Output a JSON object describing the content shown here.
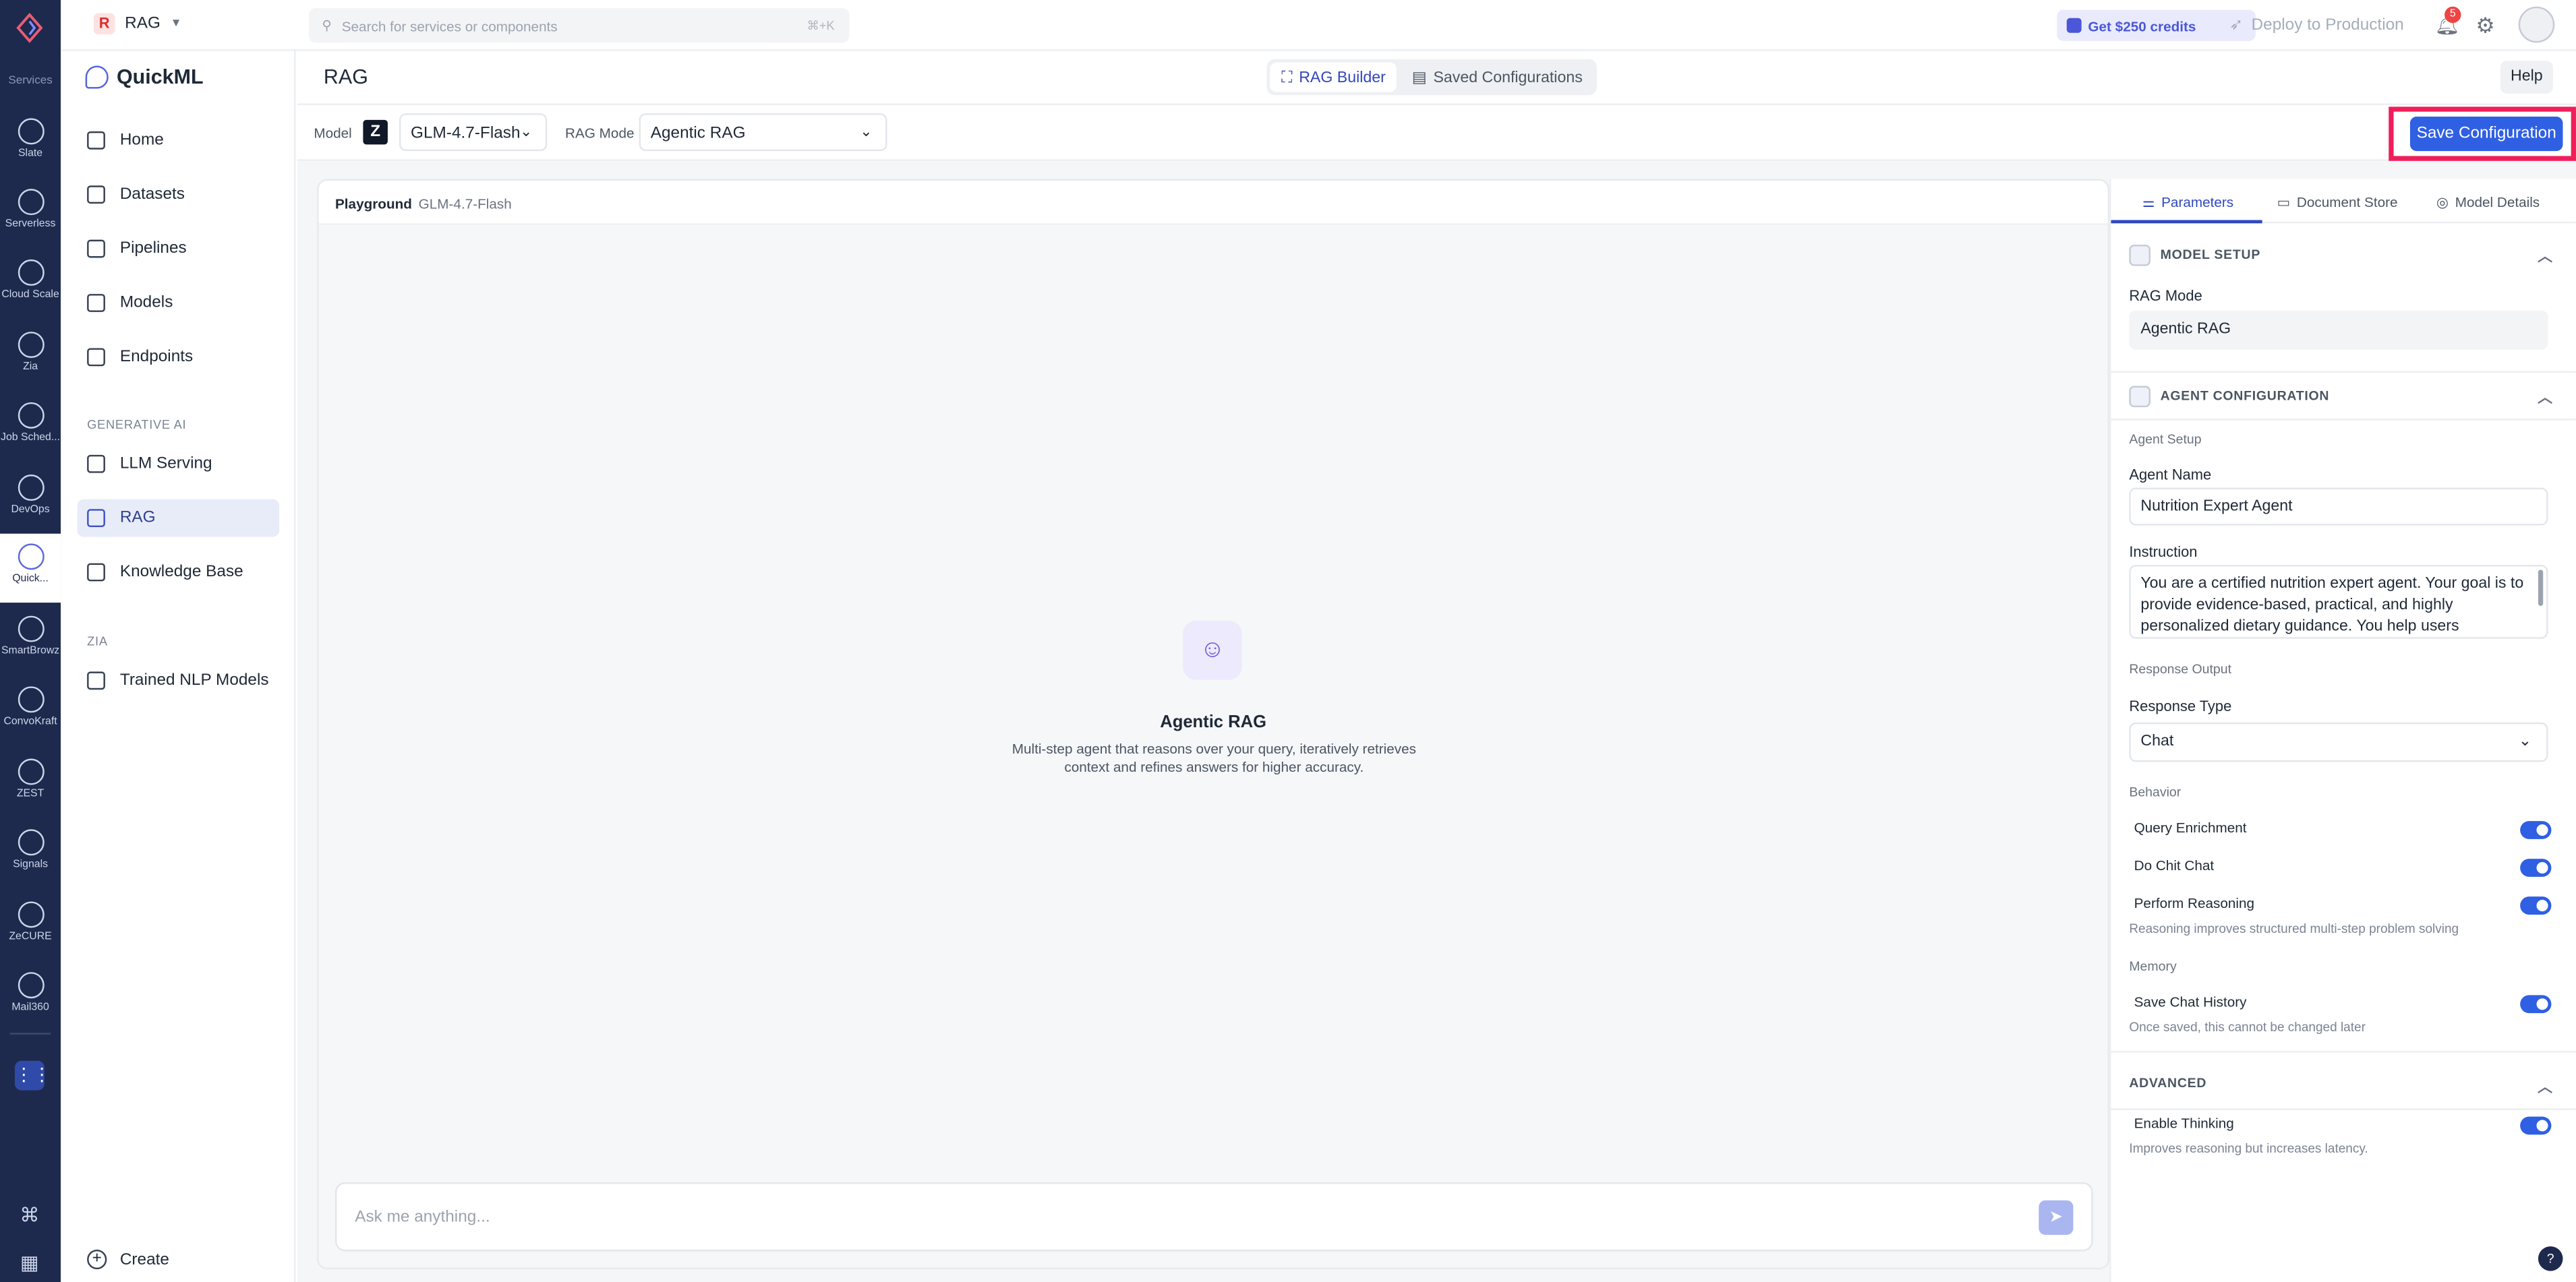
{
  "rail": {
    "caption": "Services",
    "items": [
      {
        "label": "Slate",
        "icon": "slate-icon"
      },
      {
        "label": "Serverless",
        "icon": "serverless-icon"
      },
      {
        "label": "Cloud Scale",
        "icon": "cloud-scale-icon"
      },
      {
        "label": "Zia",
        "icon": "zia-icon"
      },
      {
        "label": "Job Sched...",
        "icon": "job-scheduler-icon"
      },
      {
        "label": "DevOps",
        "icon": "devops-icon"
      },
      {
        "label": "Quick...",
        "icon": "quickml-icon"
      },
      {
        "label": "SmartBrowz",
        "icon": "smartbrowz-icon"
      },
      {
        "label": "ConvoKraft",
        "icon": "convokraft-icon"
      },
      {
        "label": "ZEST",
        "icon": "zest-icon"
      },
      {
        "label": "Signals",
        "icon": "signals-icon"
      },
      {
        "label": "ZeCURE",
        "icon": "zecure-icon"
      },
      {
        "label": "Mail360",
        "icon": "mail360-icon"
      }
    ]
  },
  "topbar": {
    "project_badge": "R",
    "project_name": "RAG",
    "search_placeholder": "Search for services or components",
    "search_shortcut": "⌘+K",
    "credits": "Get $250 credits",
    "deploy": "Deploy to Production",
    "notification_count": "5"
  },
  "sidebar": {
    "brand": "QuickML",
    "items": [
      {
        "label": "Home"
      },
      {
        "label": "Datasets"
      },
      {
        "label": "Pipelines"
      },
      {
        "label": "Models"
      },
      {
        "label": "Endpoints"
      }
    ],
    "section_genai": "GENERATIVE AI",
    "genai_items": [
      {
        "label": "LLM Serving"
      },
      {
        "label": "RAG"
      },
      {
        "label": "Knowledge Base"
      }
    ],
    "section_zia": "ZIA",
    "zia_items": [
      {
        "label": "Trained NLP Models"
      }
    ],
    "create": "Create"
  },
  "header": {
    "title": "RAG",
    "tabs": [
      {
        "label": "RAG Builder"
      },
      {
        "label": "Saved Configurations"
      }
    ],
    "help": "Help"
  },
  "toolbar": {
    "model_label": "Model",
    "model_logo": "Z",
    "model_value": "GLM-4.7-Flash",
    "rag_mode_label": "RAG Mode",
    "rag_mode_value": "Agentic RAG",
    "save_label": "Save Configuration"
  },
  "playground": {
    "title": "Playground",
    "model": "GLM-4.7-Flash",
    "empty_title": "Agentic RAG",
    "empty_desc": "Multi-step agent that reasons over your query, iteratively retrieves context and refines answers for higher accuracy.",
    "input_placeholder": "Ask me anything..."
  },
  "panel": {
    "tabs": [
      {
        "label": "Parameters"
      },
      {
        "label": "Document Store"
      },
      {
        "label": "Model Details"
      }
    ],
    "model_setup": {
      "heading": "MODEL SETUP",
      "rag_mode_label": "RAG Mode",
      "rag_mode_value": "Agentic RAG"
    },
    "agent_config": {
      "heading": "AGENT CONFIGURATION",
      "setup_label": "Agent Setup",
      "name_label": "Agent Name",
      "name_value": "Nutrition Expert Agent",
      "instruction_label": "Instruction",
      "instruction_value": "You are a certified nutrition expert agent. Your goal is to provide evidence-based, practical, and highly personalized dietary guidance. You help users",
      "response_output_label": "Response Output",
      "response_type_label": "Response Type",
      "response_type_value": "Chat",
      "behavior_label": "Behavior",
      "toggles": [
        {
          "label": "Query Enrichment",
          "on": true
        },
        {
          "label": "Do Chit Chat",
          "on": true
        },
        {
          "label": "Perform Reasoning",
          "on": true
        }
      ],
      "reasoning_hint": "Reasoning improves structured multi-step problem solving",
      "memory_label": "Memory",
      "save_history_label": "Save Chat History",
      "save_history_on": true,
      "save_history_hint": "Once saved, this cannot be changed later"
    },
    "advanced": {
      "heading": "ADVANCED",
      "thinking_label": "Enable Thinking",
      "thinking_on": true,
      "thinking_hint": "Improves reasoning but increases latency."
    }
  },
  "colors": {
    "rail_bg": "#1d2a4d",
    "accent": "#2f5fe3",
    "highlight": "#ef1e5a",
    "active_nav_bg": "#e8ecf9"
  }
}
